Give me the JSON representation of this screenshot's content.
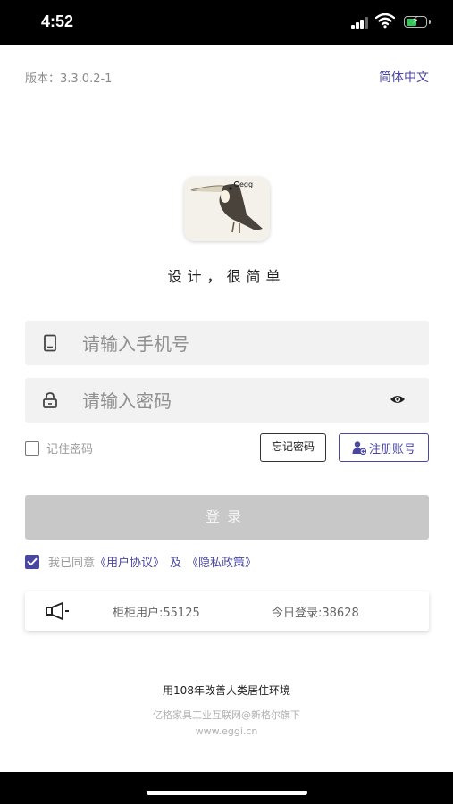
{
  "status_bar": {
    "time": "4:52"
  },
  "header": {
    "version": "版本：3.3.0.2-1",
    "language": "简体中文"
  },
  "logo": {
    "brand_text": "egg"
  },
  "slogan": "设计，很简单",
  "form": {
    "phone_placeholder": "请输入手机号",
    "password_placeholder": "请输入密码",
    "remember_label": "记住密码",
    "forgot_label": "忘记密码",
    "register_label": "注册账号",
    "login_label": "登录"
  },
  "agreement": {
    "prefix": "我已同意",
    "user_agreement": "《用户协议》",
    "and": "及",
    "privacy_policy": "《隐私政策》"
  },
  "stats": {
    "users": "柜柜用户:55125",
    "today_logins": "今日登录:38628"
  },
  "footer": {
    "line1": "用108年改善人类居住环境",
    "line2": "亿格家具工业互联网@新格尔旗下",
    "line3": "www.eggi.cn"
  },
  "colors": {
    "accent": "#4a47a3",
    "login_disabled": "#c8c8c8",
    "field_bg": "#f2f2f2"
  }
}
